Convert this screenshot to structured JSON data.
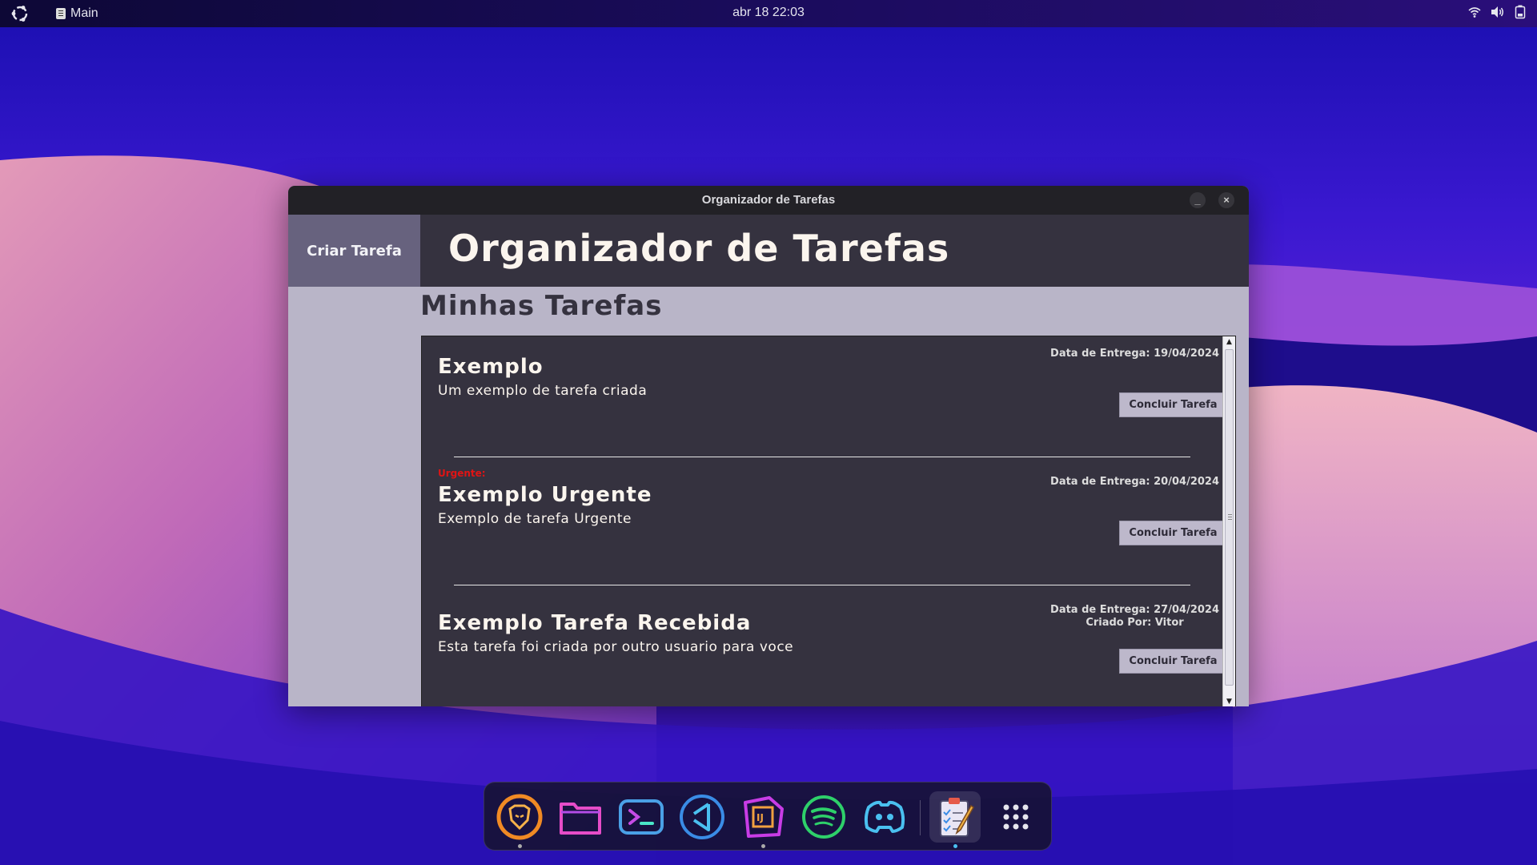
{
  "topbar": {
    "app_name": "Main",
    "clock": "abr 18  22:03"
  },
  "window": {
    "title": "Organizador de Tarefas",
    "sidebar_button": "Criar Tarefa",
    "header_title": "Organizador de Tarefas",
    "section_title": "Minhas Tarefas",
    "tasks": [
      {
        "urgent_label": "",
        "name": "Exemplo",
        "description": "Um exemplo de tarefa criada",
        "date": "Data de Entrega: 19/04/2024",
        "creator": "",
        "button": "Concluir Tarefa"
      },
      {
        "urgent_label": "Urgente:",
        "name": "Exemplo Urgente",
        "description": "Exemplo de tarefa Urgente",
        "date": "Data de Entrega: 20/04/2024",
        "creator": "",
        "button": "Concluir Tarefa"
      },
      {
        "urgent_label": "",
        "name": "Exemplo Tarefa Recebida",
        "description": "Esta tarefa foi criada por outro usuario para voce",
        "date": "Data de Entrega: 27/04/2024",
        "creator": "Criado Por: Vitor",
        "button": "Concluir Tarefa"
      }
    ]
  },
  "dock": {
    "items": [
      {
        "icon": "brave-browser-icon"
      },
      {
        "icon": "files-folder-icon"
      },
      {
        "icon": "terminal-icon"
      },
      {
        "icon": "vscode-icon"
      },
      {
        "icon": "intellij-idea-icon"
      },
      {
        "icon": "spotify-icon"
      },
      {
        "icon": "discord-icon"
      },
      {
        "icon": "task-organizer-app-icon"
      },
      {
        "icon": "show-apps-grid-icon"
      }
    ]
  },
  "colors": {
    "header_bg": "#35323f",
    "sidebar_button_bg": "#67627e",
    "content_bg": "#b9b5c8",
    "urgent": "#e01414",
    "title_text": "#fbf5ee"
  }
}
